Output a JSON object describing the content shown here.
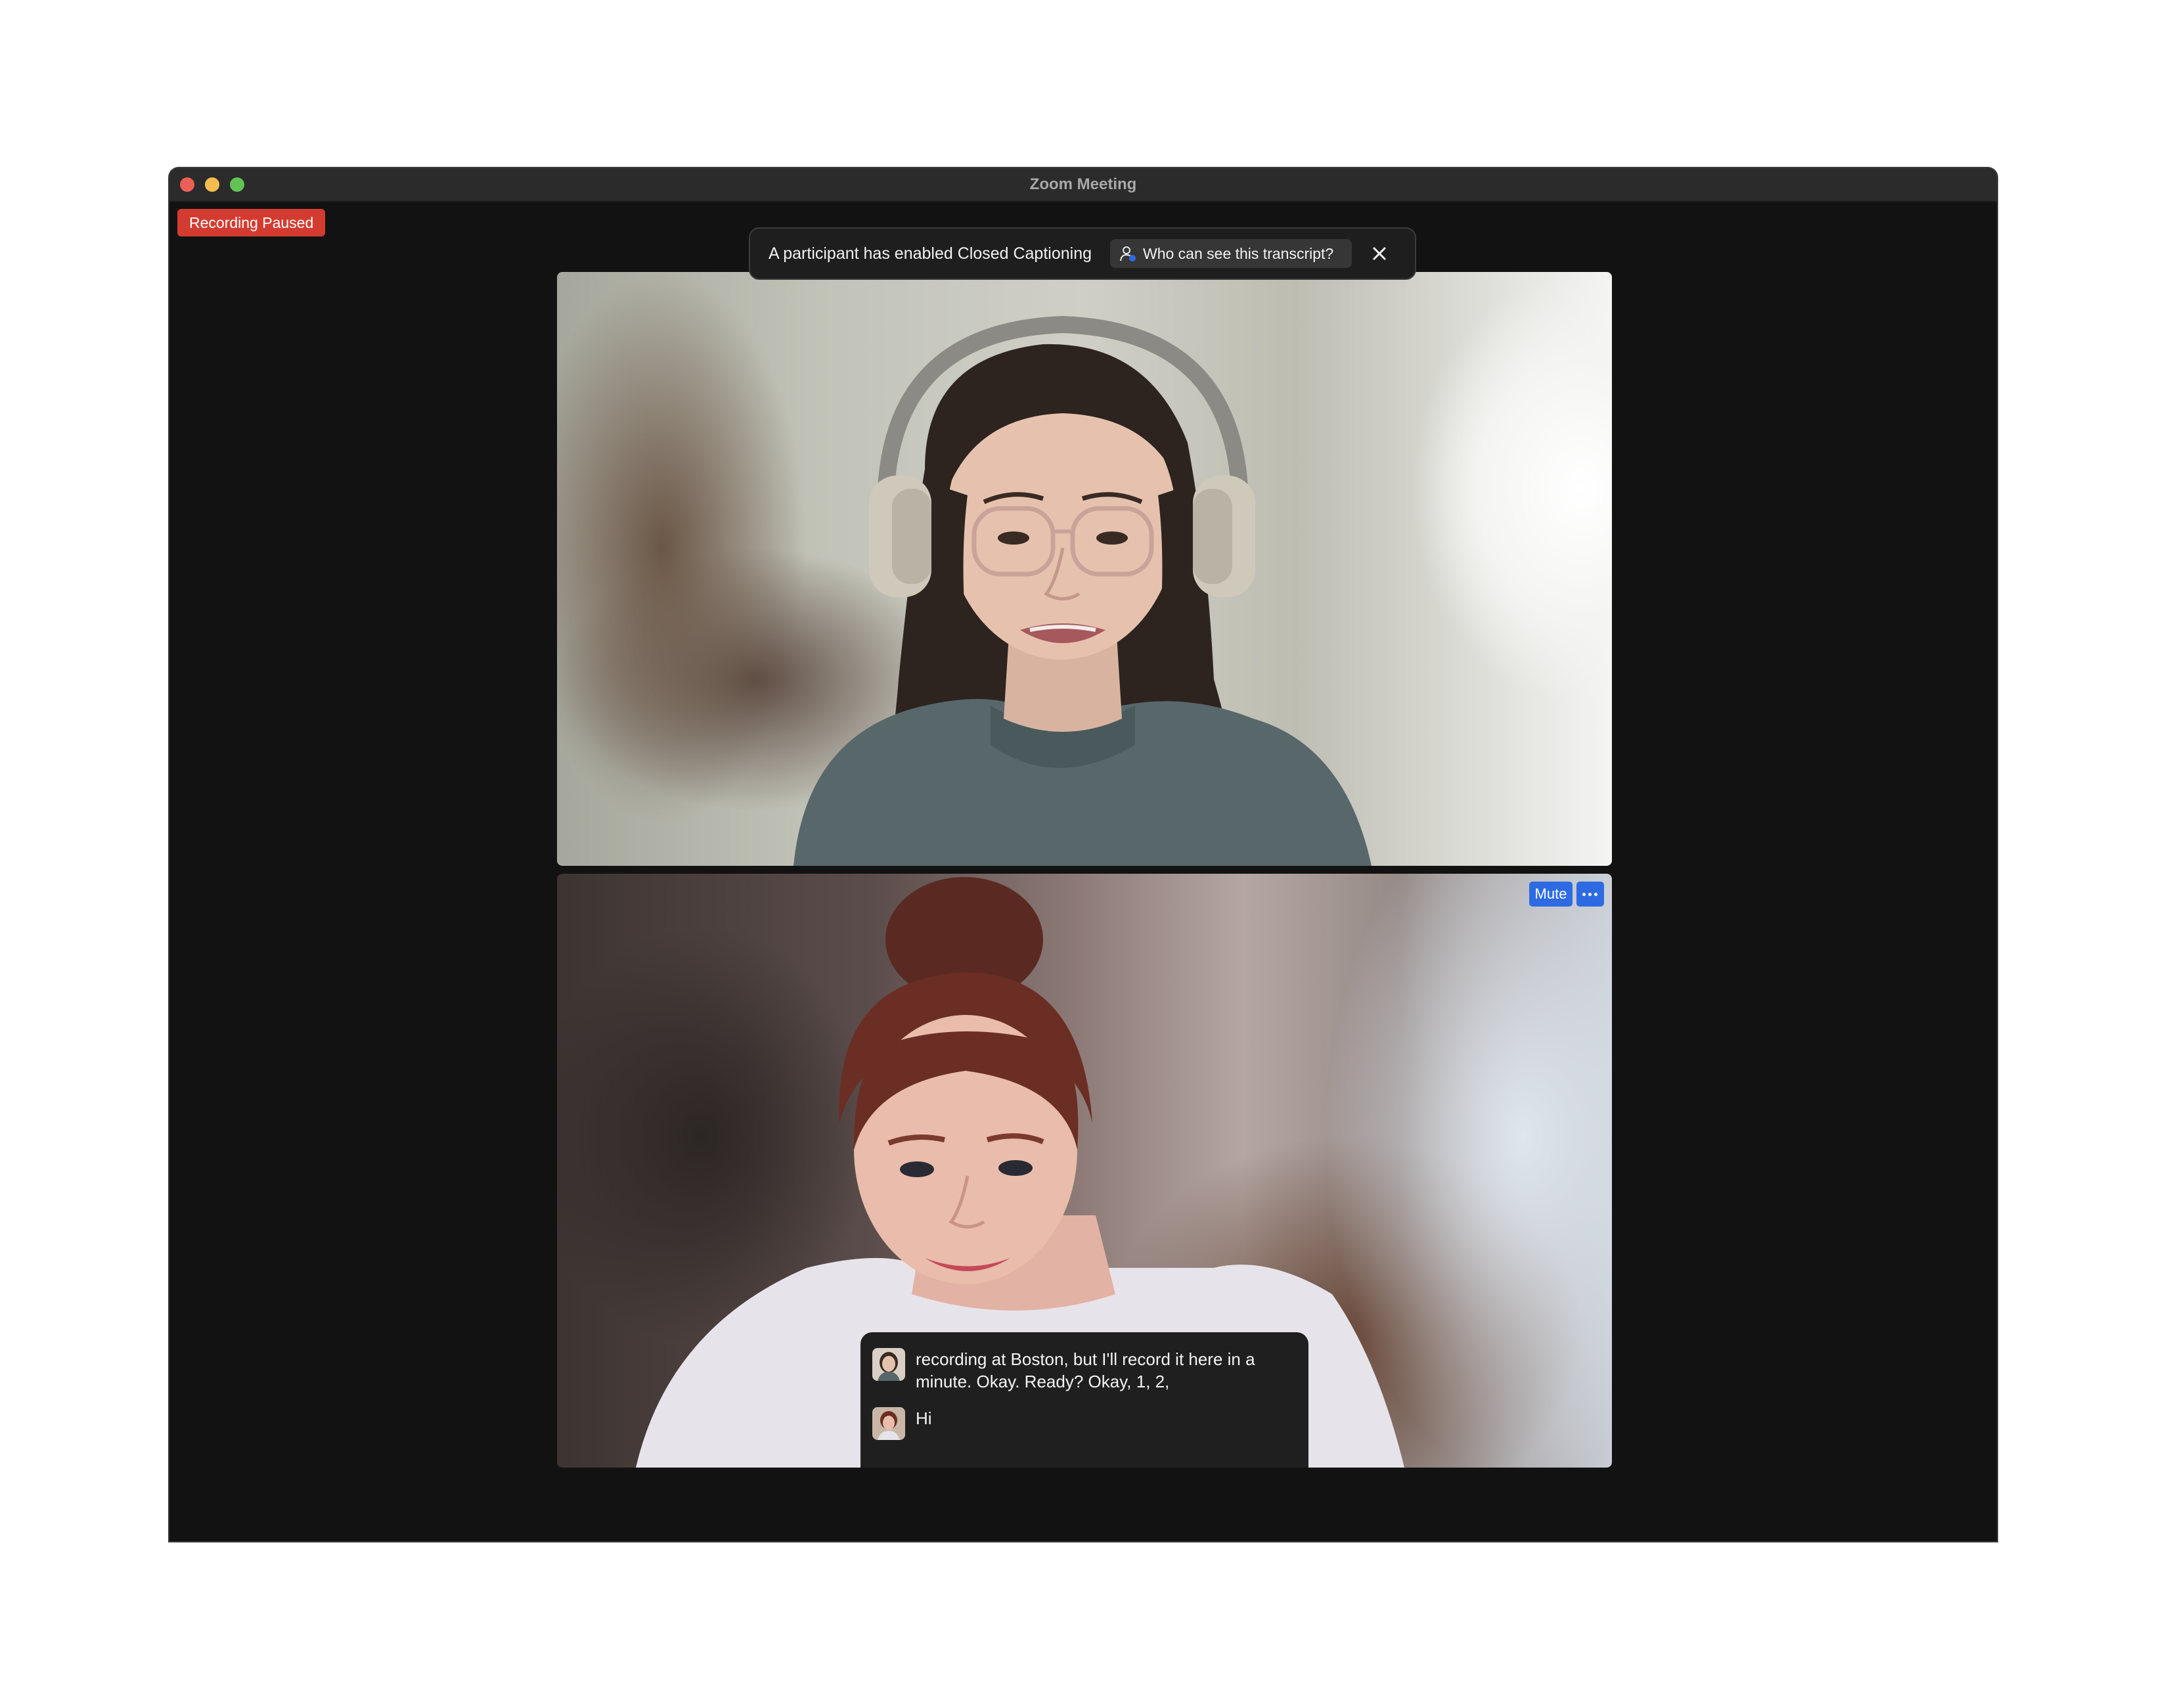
{
  "window": {
    "title": "Zoom Meeting"
  },
  "recording": {
    "badge": "Recording Paused",
    "color": "#d43b30"
  },
  "cc_banner": {
    "message": "A participant has enabled Closed Captioning",
    "who_button": "Who can see this transcript?",
    "who_icon": "person-icon",
    "close_icon": "close-icon"
  },
  "video_tiles": [
    {
      "id": "participant-1"
    },
    {
      "id": "participant-2"
    }
  ],
  "tile_controls": {
    "mute_label": "Mute",
    "more_icon": "ellipsis-icon",
    "accent": "#2e6be3"
  },
  "captions": [
    {
      "avatar": "participant-avatar-1",
      "text": "recording at Boston, but I'll record it here in a minute. Okay. Ready? Okay, 1, 2,"
    },
    {
      "avatar": "participant-avatar-2",
      "text": "Hi"
    }
  ]
}
